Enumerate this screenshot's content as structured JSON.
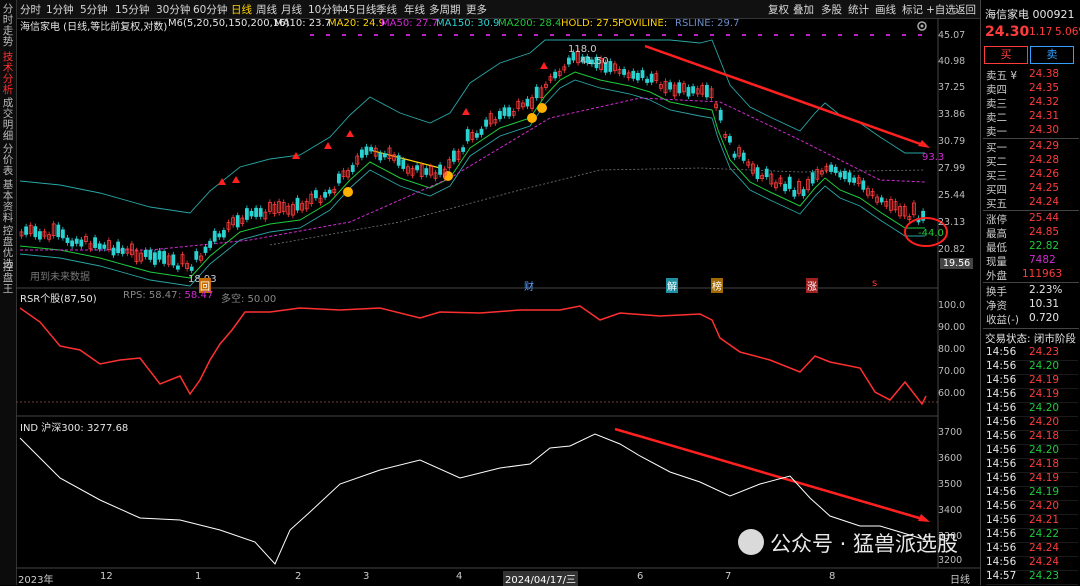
{
  "toolbar": {
    "items": [
      "分时",
      "1分钟",
      "5分钟",
      "15分钟",
      "30分钟",
      "60分钟",
      "日线",
      "周线",
      "月线",
      "10分钟",
      "45日线",
      "季线",
      "年线",
      "多周期",
      "更多"
    ],
    "active": "日线",
    "right_items": [
      "复权",
      "叠加",
      "多股",
      "统计",
      "画线",
      "标记",
      "+自选",
      "返回"
    ]
  },
  "left_tabs": [
    "分时走势",
    "技术分析",
    "成交明细",
    "分价表",
    "基本资料",
    "控盘优选",
    "控盘王"
  ],
  "main": {
    "title": "海信家电 (日线,等比前复权,对数)",
    "indicators": [
      {
        "label": "M6(5,20,50,150,200,16)",
        "color": "#e6e6e6"
      },
      {
        "label": "MA10: 23.7",
        "color": "#e6e6e6"
      },
      {
        "label": "MA20: 24.9",
        "color": "#ffd200"
      },
      {
        "label": "MA50: 27.7",
        "color": "#d22bd2"
      },
      {
        "label": "MA150: 30.9",
        "color": "#33d0d0"
      },
      {
        "label": "MA200: 28.4",
        "color": "#1ecb3a"
      },
      {
        "label": "HOLD: 27.5",
        "color": "#ffd200"
      },
      {
        "label": "POVILINE:",
        "color": "#ffd200"
      },
      {
        "label": "RSLINE: 29.7",
        "color": "#6a8cc8"
      }
    ],
    "price_ticks": [
      "45.07",
      "40.98",
      "37.25",
      "33.86",
      "30.79",
      "27.99",
      "25.44",
      "23.13",
      "20.82"
    ],
    "price_highlight": "19.56",
    "annotations": {
      "high_label": "118.0",
      "high_price": "41.50",
      "low_price": "18.93",
      "rs_label": "93.3",
      "change_label": "-44.0",
      "no_data": "用到未来数据"
    },
    "event_markers": [
      "回",
      "财",
      "解",
      "榜",
      "涨",
      "s"
    ]
  },
  "rsr": {
    "title": "RSR个股(87,50)",
    "values": [
      {
        "label": "RPS: 58.47",
        "color": "#888"
      },
      {
        "label": ": 58.47",
        "color": "#d22bd2"
      },
      {
        "label": "多空: 50.00",
        "color": "#888"
      }
    ],
    "ticks": [
      "100.0",
      "90.00",
      "80.00",
      "70.00",
      "60.00"
    ]
  },
  "ind": {
    "title": "IND 沪深300: 3277.68",
    "ticks": [
      "3700",
      "3600",
      "3500",
      "3400",
      "3300",
      "3200"
    ]
  },
  "xaxis": {
    "labels": [
      "2023年",
      "12",
      "1",
      "2",
      "3",
      "4",
      "2024/04/17/三",
      "6",
      "7",
      "8"
    ],
    "period": "日线"
  },
  "quote": {
    "name": "海信家电 000921",
    "price": "24.30",
    "change": "1.17",
    "pct": "5.06%",
    "buy_btn": "买",
    "sell_btn": "卖",
    "asks": [
      {
        "label": "卖五 ¥",
        "price": "24.38"
      },
      {
        "label": "卖四",
        "price": "24.35"
      },
      {
        "label": "卖三",
        "price": "24.32"
      },
      {
        "label": "卖二",
        "price": "24.31"
      },
      {
        "label": "卖一",
        "price": "24.30"
      }
    ],
    "bids": [
      {
        "label": "买一",
        "price": "24.29"
      },
      {
        "label": "买二",
        "price": "24.28"
      },
      {
        "label": "买三",
        "price": "24.26"
      },
      {
        "label": "买四",
        "price": "24.25"
      },
      {
        "label": "买五",
        "price": "24.24"
      }
    ],
    "stats": [
      {
        "label": "涨停",
        "value": "25.44",
        "color": "#ff3c3c"
      },
      {
        "label": "最高",
        "value": "24.85",
        "color": "#ff3c3c"
      },
      {
        "label": "最低",
        "value": "22.82",
        "color": "#1ecb3a"
      },
      {
        "label": "现量",
        "value": "7482",
        "color": "#d22bd2"
      },
      {
        "label": "外盘",
        "value": "111963",
        "color": "#ff3c3c"
      },
      {
        "label": "换手",
        "value": "2.23%",
        "color": "#e6e6e6"
      },
      {
        "label": "净资",
        "value": "10.31",
        "color": "#e6e6e6"
      },
      {
        "label": "收益(-)",
        "value": "0.720",
        "color": "#e6e6e6"
      }
    ],
    "trade_status": "交易状态: 闭市阶段",
    "ticks": [
      {
        "time": "14:56",
        "price": "24.23"
      },
      {
        "time": "14:56",
        "price": "24.20"
      },
      {
        "time": "14:56",
        "price": "24.19"
      },
      {
        "time": "14:56",
        "price": "24.19"
      },
      {
        "time": "14:56",
        "price": "24.20"
      },
      {
        "time": "14:56",
        "price": "24.20"
      },
      {
        "time": "14:56",
        "price": "24.18"
      },
      {
        "time": "14:56",
        "price": "24.20"
      },
      {
        "time": "14:56",
        "price": "24.18"
      },
      {
        "time": "14:56",
        "price": "24.19"
      },
      {
        "time": "14:56",
        "price": "24.19"
      },
      {
        "time": "14:56",
        "price": "24.20"
      },
      {
        "time": "14:56",
        "price": "24.21"
      },
      {
        "time": "14:56",
        "price": "24.22"
      },
      {
        "time": "14:56",
        "price": "24.24"
      },
      {
        "time": "14:56",
        "price": "24.24"
      },
      {
        "time": "14:57",
        "price": "24.23"
      }
    ]
  },
  "watermark": "公众号 · 猛兽派选股",
  "colors": {
    "up": "#ff3c3c",
    "down": "#1ecb3a",
    "ma150": "#33d0d0",
    "ma200": "#1ecb3a",
    "ma50": "#d22bd2",
    "rsr": "#ff3030",
    "rsr_low": "#ff8ad8",
    "ind": "#ffffff",
    "trend": "#ff2020"
  }
}
